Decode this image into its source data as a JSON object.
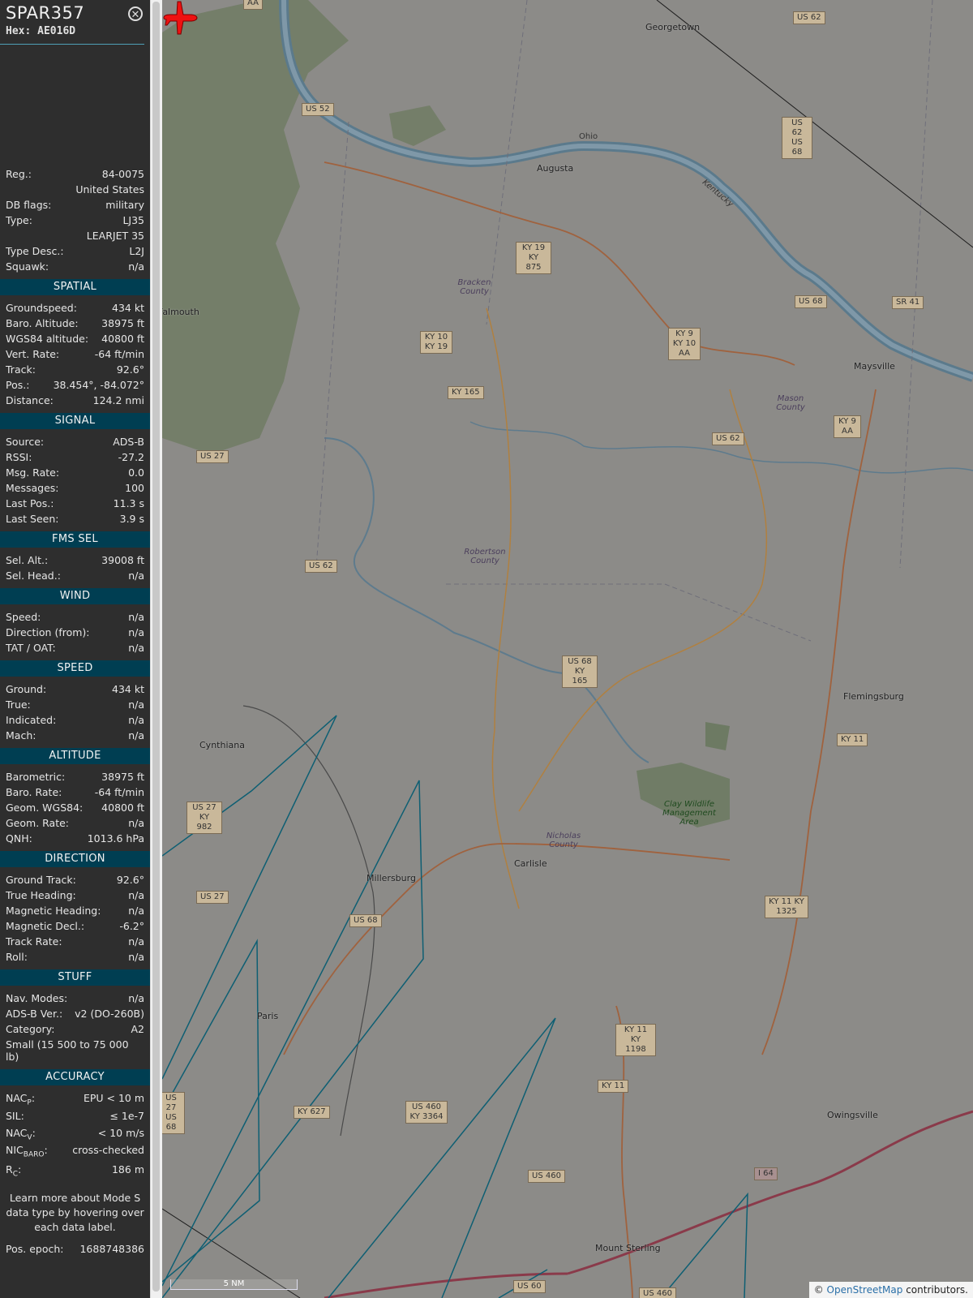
{
  "header": {
    "callsign": "SPAR357",
    "hex": "Hex: AE016D"
  },
  "info": [
    {
      "k": "Reg.:",
      "v": "84-0075"
    },
    {
      "k": "",
      "v": "United States"
    },
    {
      "k": "DB flags:",
      "v": "military"
    },
    {
      "k": "Type:",
      "v": "LJ35"
    },
    {
      "k": "",
      "v": "LEARJET 35"
    },
    {
      "k": "Type Desc.:",
      "v": "L2J"
    },
    {
      "k": "Squawk:",
      "v": "n/a"
    }
  ],
  "spatial": {
    "title": "SPATIAL",
    "rows": [
      {
        "k": "Groundspeed:",
        "v": "434 kt"
      },
      {
        "k": "Baro. Altitude:",
        "v": "38975 ft"
      },
      {
        "k": "WGS84 altitude:",
        "v": "40800 ft"
      },
      {
        "k": "Vert. Rate:",
        "v": "-64 ft/min"
      },
      {
        "k": "Track:",
        "v": "92.6°"
      },
      {
        "k": "Pos.:",
        "v": "38.454°, -84.072°"
      },
      {
        "k": "Distance:",
        "v": "124.2 nmi"
      }
    ]
  },
  "signal": {
    "title": "SIGNAL",
    "rows": [
      {
        "k": "Source:",
        "v": "ADS-B"
      },
      {
        "k": "RSSI:",
        "v": "-27.2"
      },
      {
        "k": "Msg. Rate:",
        "v": "0.0"
      },
      {
        "k": "Messages:",
        "v": "100"
      },
      {
        "k": "Last Pos.:",
        "v": "11.3 s"
      },
      {
        "k": "Last Seen:",
        "v": "3.9 s"
      }
    ]
  },
  "fms": {
    "title": "FMS SEL",
    "rows": [
      {
        "k": "Sel. Alt.:",
        "v": "39008 ft"
      },
      {
        "k": "Sel. Head.:",
        "v": "n/a"
      }
    ]
  },
  "wind": {
    "title": "WIND",
    "rows": [
      {
        "k": "Speed:",
        "v": "n/a"
      },
      {
        "k": "Direction (from):",
        "v": "n/a"
      },
      {
        "k": "TAT / OAT:",
        "v": "n/a"
      }
    ]
  },
  "speed": {
    "title": "SPEED",
    "rows": [
      {
        "k": "Ground:",
        "v": "434 kt"
      },
      {
        "k": "True:",
        "v": "n/a"
      },
      {
        "k": "Indicated:",
        "v": "n/a"
      },
      {
        "k": "Mach:",
        "v": "n/a"
      }
    ]
  },
  "altitude": {
    "title": "ALTITUDE",
    "rows": [
      {
        "k": "Barometric:",
        "v": "38975 ft"
      },
      {
        "k": "Baro. Rate:",
        "v": "-64 ft/min"
      },
      {
        "k": "Geom. WGS84:",
        "v": "40800 ft"
      },
      {
        "k": "Geom. Rate:",
        "v": "n/a"
      },
      {
        "k": "QNH:",
        "v": "1013.6 hPa"
      }
    ]
  },
  "direction": {
    "title": "DIRECTION",
    "rows": [
      {
        "k": "Ground Track:",
        "v": "92.6°"
      },
      {
        "k": "True Heading:",
        "v": "n/a"
      },
      {
        "k": "Magnetic Heading:",
        "v": "n/a"
      },
      {
        "k": "Magnetic Decl.:",
        "v": "-6.2°"
      },
      {
        "k": "Track Rate:",
        "v": "n/a"
      },
      {
        "k": "Roll:",
        "v": "n/a"
      }
    ]
  },
  "stuff": {
    "title": "STUFF",
    "rows": [
      {
        "k": "Nav. Modes:",
        "v": "n/a"
      },
      {
        "k": "ADS-B Ver.:",
        "v": "v2 (DO-260B)"
      },
      {
        "k": "Category:",
        "v": "A2"
      }
    ],
    "category_desc": "Small (15 500 to 75 000 lb)"
  },
  "accuracy": {
    "title": "ACCURACY",
    "nacp_k": "NAC",
    "nacp_sub": "P",
    "nacp_v": "EPU < 10 m",
    "sil_k": "SIL:",
    "sil_v": "≤ 1e-7",
    "nacv_k": "NAC",
    "nacv_sub": "V",
    "nacv_v": "< 10 m/s",
    "nicb_k": "NIC",
    "nicb_sub": "BARO",
    "nicb_v": "cross-checked",
    "rc_k": "R",
    "rc_sub": "C",
    "rc_v": "186 m"
  },
  "note": "Learn more about Mode S data type by hovering over each data label.",
  "epoch": {
    "k": "Pos. epoch:",
    "v": "1688748386"
  },
  "map": {
    "towns": [
      "Georgetown",
      "Augusta",
      "Falmouth",
      "Maysville",
      "Cynthiana",
      "Flemingsburg",
      "Millersburg",
      "Carlisle",
      "Paris",
      "Owingsville",
      "Mount Sterling"
    ],
    "counties": [
      "Bracken County",
      "Mason County",
      "Robertson County",
      "Nicholas County",
      "Clay Wildlife Management Area"
    ],
    "river": "Ohio",
    "state": "Kentucky",
    "shields": [
      "US 62",
      "US 52",
      "US 62 US 68",
      "KY 19 KY 875",
      "KY 10 KY 19",
      "KY 9 KY 10 AA",
      "US 68",
      "SR 41",
      "KY 165",
      "US 27",
      "US 62",
      "KY 9 AA",
      "US 62",
      "US 68 KY 165",
      "KY 11",
      "US 27 KY 982",
      "US 27",
      "US 68",
      "KY 11 KY 1325",
      "KY 11 KY 1198",
      "KY 11",
      "KY 627",
      "US 460 KY 3364",
      "US 460",
      "I 64",
      "US 60",
      "US 460",
      "US 27 US 68",
      "AA"
    ],
    "scale": "5 NM",
    "attribution_prefix": "©",
    "attribution_link": "OpenStreetMap",
    "attribution_suffix": "contributors."
  }
}
